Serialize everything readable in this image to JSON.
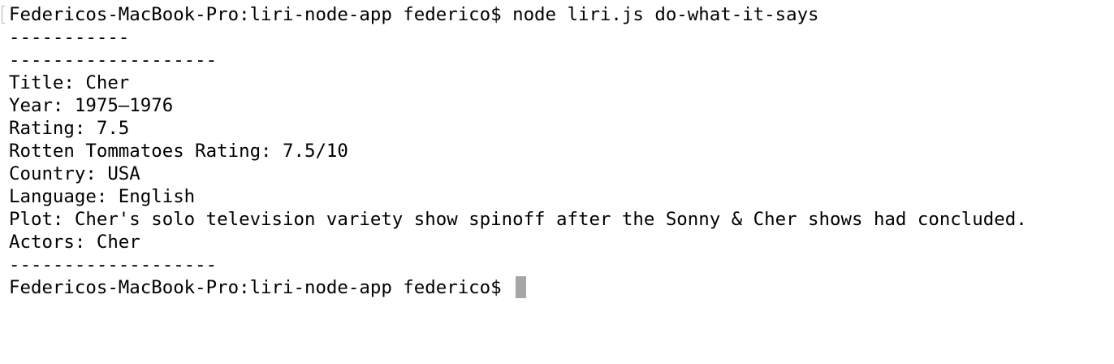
{
  "terminal": {
    "lines": [
      "Federicos-MacBook-Pro:liri-node-app federico$ node liri.js do-what-it-says",
      "-----------",
      "-------------------",
      "Title: Cher",
      "Year: 1975–1976",
      "Rating: 7.5",
      "Rotten Tommatoes Rating: 7.5/10",
      "Country: USA",
      "Language: English",
      "Plot: Cher's solo television variety show spinoff after the Sonny & Cher shows had concluded.",
      "Actors: Cher",
      "-------------------"
    ],
    "prompt": "Federicos-MacBook-Pro:liri-node-app federico$"
  },
  "colors": {
    "background": "#ffffff",
    "text": "#000000",
    "cursor": "#a6a6a6"
  }
}
